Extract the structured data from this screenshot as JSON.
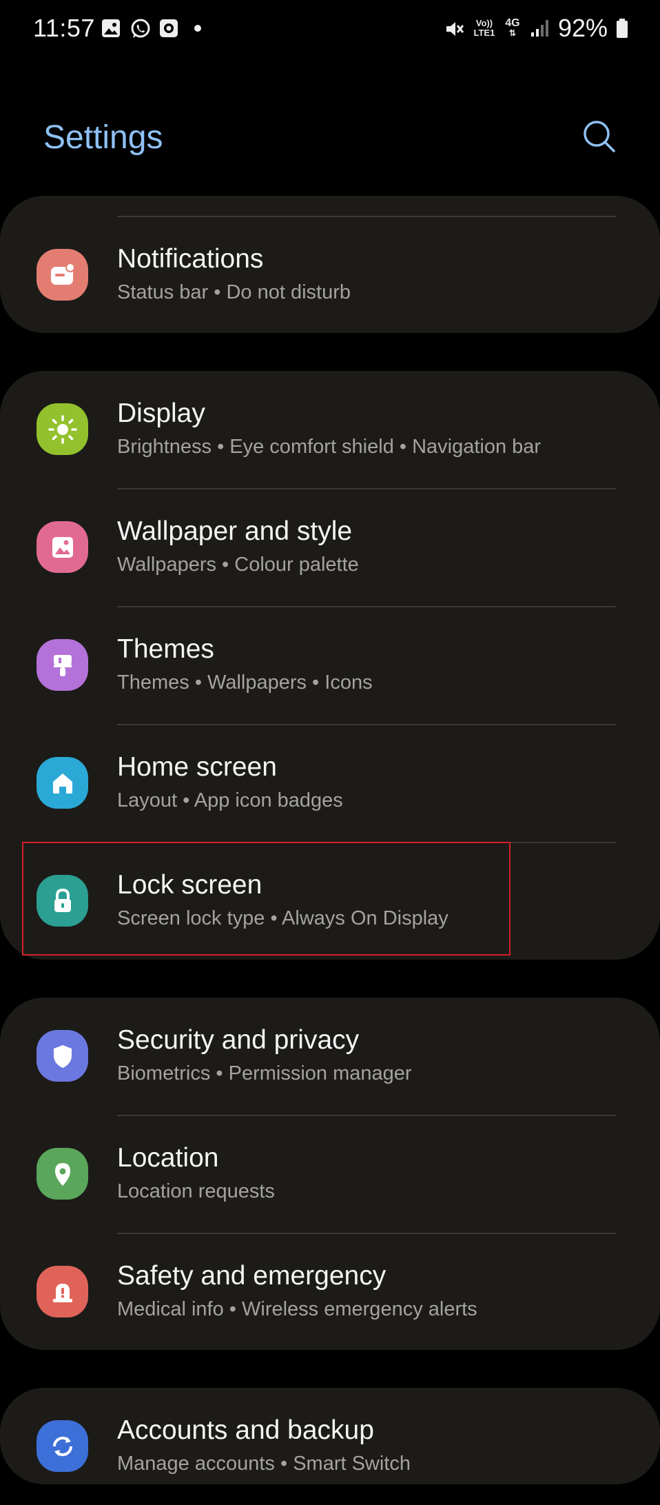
{
  "status_bar": {
    "time": "11:57",
    "left_icons": [
      "gallery-icon",
      "whatsapp-icon",
      "screen-recorder-icon",
      "dot-icon"
    ],
    "right_icons": [
      "mute-icon",
      "volte-icon",
      "network-4g-icon",
      "signal-icon",
      "battery-icon"
    ],
    "volte_label": "Vo)) LTE1",
    "network_label": "4G",
    "battery_percent": "92%"
  },
  "header": {
    "title": "Settings",
    "search_icon": "search-icon"
  },
  "sections": [
    {
      "items": [
        {
          "id": "notifications",
          "title": "Notifications",
          "subtitle": "Status bar  •  Do not disturb",
          "icon": "notifications-icon",
          "icon_color": "#e37d72"
        }
      ]
    },
    {
      "items": [
        {
          "id": "display",
          "title": "Display",
          "subtitle": "Brightness  •  Eye comfort shield  •  Navigation bar",
          "icon": "brightness-icon",
          "icon_color": "#93c12e"
        },
        {
          "id": "wallpaper",
          "title": "Wallpaper and style",
          "subtitle": "Wallpapers  •  Colour palette",
          "icon": "wallpaper-icon",
          "icon_color": "#e16a93"
        },
        {
          "id": "themes",
          "title": "Themes",
          "subtitle": "Themes  •  Wallpapers  •  Icons",
          "icon": "paint-brush-icon",
          "icon_color": "#b371d9"
        },
        {
          "id": "home_screen",
          "title": "Home screen",
          "subtitle": "Layout  •  App icon badges",
          "icon": "home-icon",
          "icon_color": "#2aa9d6"
        },
        {
          "id": "lock_screen",
          "title": "Lock screen",
          "subtitle": "Screen lock type  •  Always On Display",
          "icon": "lock-icon",
          "icon_color": "#2a9f92"
        }
      ]
    },
    {
      "items": [
        {
          "id": "security",
          "title": "Security and privacy",
          "subtitle": "Biometrics  •  Permission manager",
          "icon": "shield-icon",
          "icon_color": "#6b78e0"
        },
        {
          "id": "location",
          "title": "Location",
          "subtitle": "Location requests",
          "icon": "location-pin-icon",
          "icon_color": "#5aa65a"
        },
        {
          "id": "safety",
          "title": "Safety and emergency",
          "subtitle": "Medical info  •  Wireless emergency alerts",
          "icon": "emergency-icon",
          "icon_color": "#e0635a"
        }
      ]
    },
    {
      "items": [
        {
          "id": "accounts",
          "title": "Accounts and backup",
          "subtitle": "Manage accounts  •  Smart Switch",
          "icon": "sync-icon",
          "icon_color": "#3d6fd8"
        }
      ]
    }
  ],
  "colors": {
    "background": "#000000",
    "card": "#1c1b18",
    "title_accent": "#8fc1f5",
    "highlight_border": "#d3202c"
  }
}
